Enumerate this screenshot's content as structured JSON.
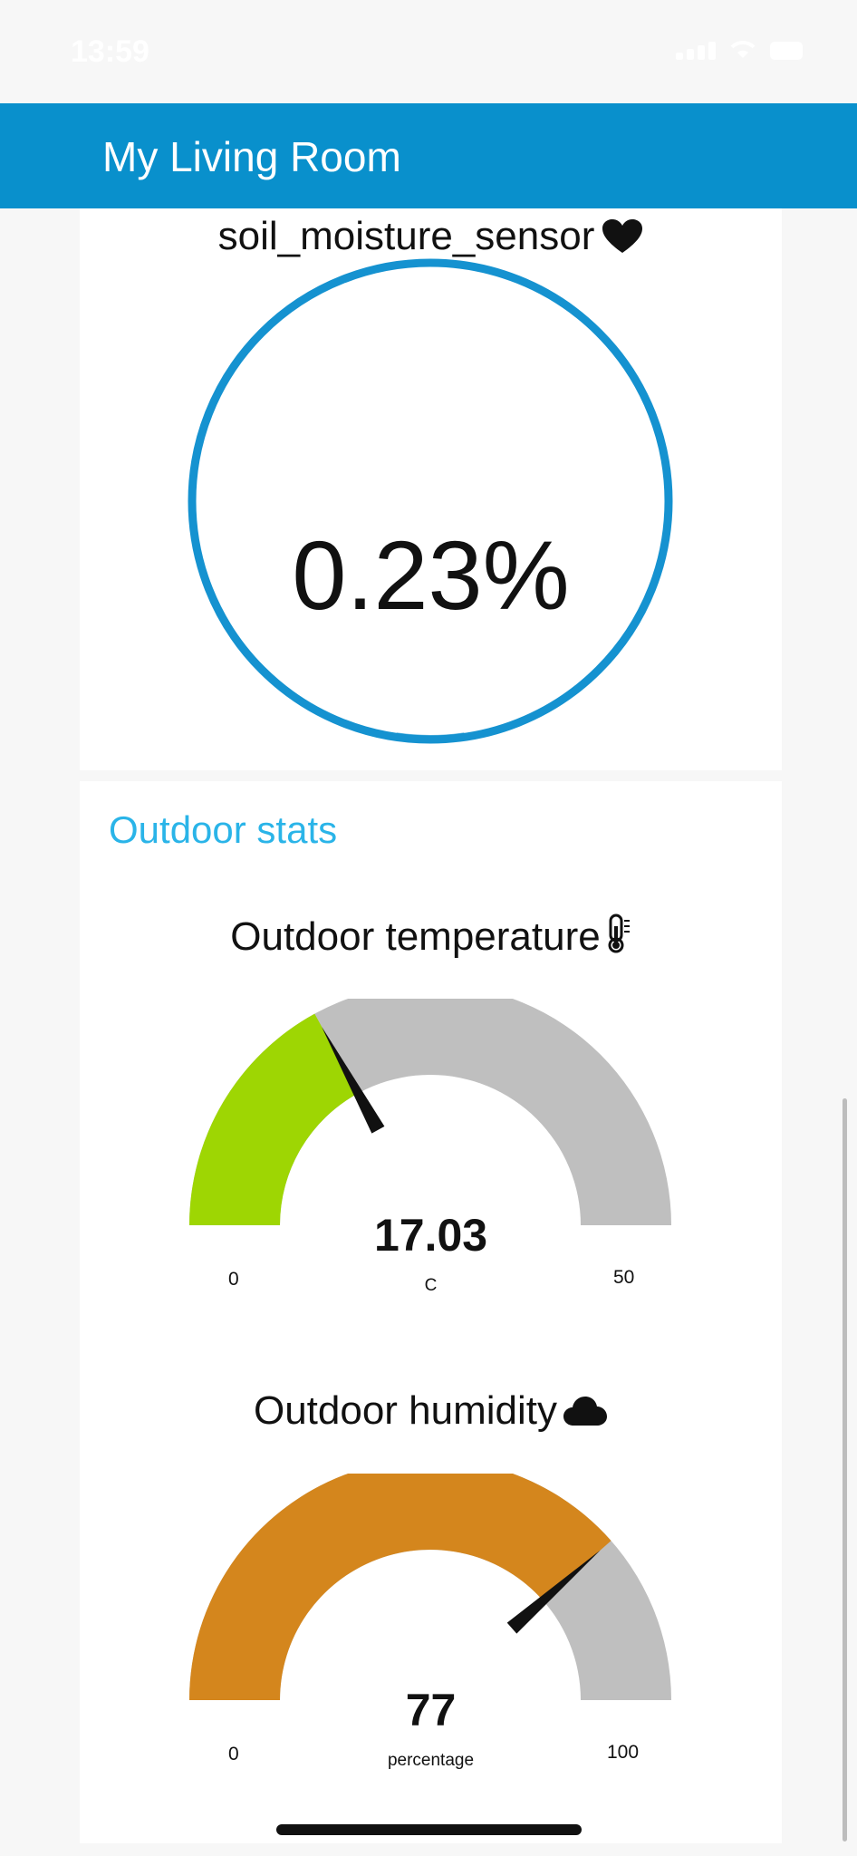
{
  "status_bar": {
    "time": "13:59"
  },
  "header": {
    "title": "My Living Room"
  },
  "soil": {
    "title": "soil_moisture_sensor",
    "value_text": "0.23%",
    "value": 0.23,
    "min": 0,
    "max": 100,
    "ring_color": "#1592d0",
    "icon": "heart-icon"
  },
  "outdoor": {
    "section_title": "Outdoor stats",
    "temperature": {
      "title": "Outdoor temperature",
      "icon": "thermometer-icon",
      "value_text": "17.03",
      "value": 17.03,
      "unit": "C",
      "min_label": "0",
      "max_label": "50",
      "min": 0,
      "max": 50,
      "fill_color": "#9ed603",
      "track_color": "#bfbfbf"
    },
    "humidity": {
      "title": "Outdoor humidity",
      "icon": "cloud-icon",
      "value_text": "77",
      "value": 77,
      "unit": "percentage",
      "min_label": "0",
      "max_label": "100",
      "min": 0,
      "max": 100,
      "fill_color": "#d4861d",
      "track_color": "#bfbfbf"
    }
  },
  "colors": {
    "header_bg": "#0990cc",
    "section_title": "#2ab4e8",
    "page_bg": "#f7f7f7"
  }
}
